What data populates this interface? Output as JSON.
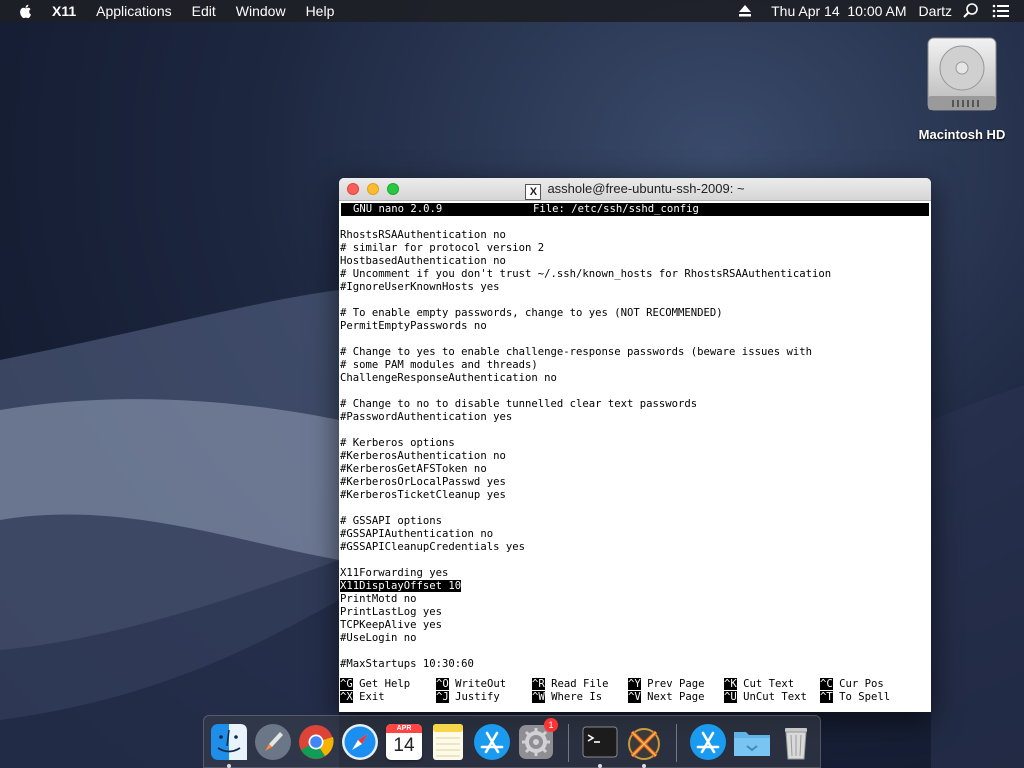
{
  "menubar": {
    "app_name": "X11",
    "menus": [
      "Applications",
      "Edit",
      "Window",
      "Help"
    ],
    "date_time": "Thu Apr 14  10:00 AM",
    "user": "Dartz"
  },
  "desktop": {
    "hd_label": "Macintosh HD"
  },
  "window": {
    "title": "asshole@free-ubuntu-ssh-2009: ~",
    "x_glyph": "X"
  },
  "nano": {
    "version": "GNU nano 2.0.9",
    "file": "File: /etc/ssh/sshd_config",
    "lines": [
      "RhostsRSAAuthentication no",
      "# similar for protocol version 2",
      "HostbasedAuthentication no",
      "# Uncomment if you don't trust ~/.ssh/known_hosts for RhostsRSAAuthentication",
      "#IgnoreUserKnownHosts yes",
      "",
      "# To enable empty passwords, change to yes (NOT RECOMMENDED)",
      "PermitEmptyPasswords no",
      "",
      "# Change to yes to enable challenge-response passwords (beware issues with",
      "# some PAM modules and threads)",
      "ChallengeResponseAuthentication no",
      "",
      "# Change to no to disable tunnelled clear text passwords",
      "#PasswordAuthentication yes",
      "",
      "# Kerberos options",
      "#KerberosAuthentication no",
      "#KerberosGetAFSToken no",
      "#KerberosOrLocalPasswd yes",
      "#KerberosTicketCleanup yes",
      "",
      "# GSSAPI options",
      "#GSSAPIAuthentication no",
      "#GSSAPICleanupCredentials yes",
      "",
      "X11Forwarding yes",
      "X11DisplayOffset 10",
      "PrintMotd no",
      "PrintLastLog yes",
      "TCPKeepAlive yes",
      "#UseLogin no",
      "",
      "#MaxStartups 10:30:60"
    ],
    "cursor_line": 27,
    "shortcuts_row1": [
      {
        "key": "^G",
        "label": "Get Help"
      },
      {
        "key": "^O",
        "label": "WriteOut"
      },
      {
        "key": "^R",
        "label": "Read File"
      },
      {
        "key": "^Y",
        "label": "Prev Page"
      },
      {
        "key": "^K",
        "label": "Cut Text"
      },
      {
        "key": "^C",
        "label": "Cur Pos"
      }
    ],
    "shortcuts_row2": [
      {
        "key": "^X",
        "label": "Exit"
      },
      {
        "key": "^J",
        "label": "Justify"
      },
      {
        "key": "^W",
        "label": "Where Is"
      },
      {
        "key": "^V",
        "label": "Next Page"
      },
      {
        "key": "^U",
        "label": "UnCut Text"
      },
      {
        "key": "^T",
        "label": "To Spell"
      }
    ]
  },
  "dock": {
    "calendar_month": "APR",
    "calendar_day": "14",
    "badge_count": "1",
    "apps": [
      "finder-icon",
      "launchpad-icon",
      "chrome-icon",
      "safari-icon",
      "calendar-icon",
      "notes-icon",
      "app-store-icon",
      "system-preferences-icon",
      "terminal-icon",
      "xquartz-icon",
      "app-store-downloads-icon",
      "folder-icon",
      "trash-icon"
    ]
  },
  "colors": {
    "close": "#fc5f57",
    "minimize": "#fdbc2e",
    "maximize": "#28c840"
  }
}
